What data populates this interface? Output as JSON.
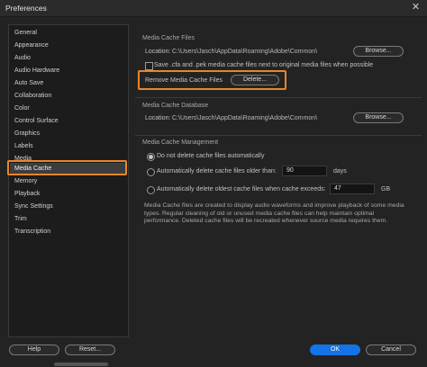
{
  "window": {
    "title": "Preferences"
  },
  "sidebar": {
    "items": [
      {
        "label": "General"
      },
      {
        "label": "Appearance"
      },
      {
        "label": "Audio"
      },
      {
        "label": "Audio Hardware"
      },
      {
        "label": "Auto Save"
      },
      {
        "label": "Collaboration"
      },
      {
        "label": "Color"
      },
      {
        "label": "Control Surface"
      },
      {
        "label": "Graphics"
      },
      {
        "label": "Labels"
      },
      {
        "label": "Media"
      },
      {
        "label": "Media Cache"
      },
      {
        "label": "Memory"
      },
      {
        "label": "Playback"
      },
      {
        "label": "Sync Settings"
      },
      {
        "label": "Trim"
      },
      {
        "label": "Transcription"
      }
    ],
    "selected": "Media Cache"
  },
  "media_cache_files": {
    "section_title": "Media Cache Files",
    "location_label": "Location:",
    "location_path": "C:\\Users\\Jasch\\AppData\\Roaming\\Adobe\\Common\\",
    "browse_label": "Browse...",
    "save_next_label": "Save .cfa and .pek media cache files next to original media files when possible",
    "save_next_checked": false,
    "remove_label": "Remove Media Cache Files",
    "delete_label": "Delete..."
  },
  "media_cache_database": {
    "section_title": "Media Cache Database",
    "location_label": "Location:",
    "location_path": "C:\\Users\\Jasch\\AppData\\Roaming\\Adobe\\Common\\",
    "browse_label": "Browse..."
  },
  "media_cache_management": {
    "section_title": "Media Cache Management",
    "options": [
      {
        "label": "Do not delete cache files automatically",
        "selected": true
      },
      {
        "label": "Automatically delete cache files older than:",
        "selected": false,
        "value": "90",
        "unit": "days"
      },
      {
        "label": "Automatically delete oldest cache files when cache exceeds:",
        "selected": false,
        "value": "47",
        "unit": "GB"
      }
    ],
    "description": "Media Cache files are created to display audio waveforms and improve playback of some media types.  Regular cleaning of old or unused media cache files can help maintain optimal performance. Deleted cache files will be recreated whenever source media requires them."
  },
  "footer": {
    "help_label": "Help",
    "reset_label": "Reset...",
    "ok_label": "OK",
    "cancel_label": "Cancel"
  },
  "colors": {
    "highlight": "#e8862a",
    "primary_button": "#1473e6",
    "background": "#232323"
  }
}
